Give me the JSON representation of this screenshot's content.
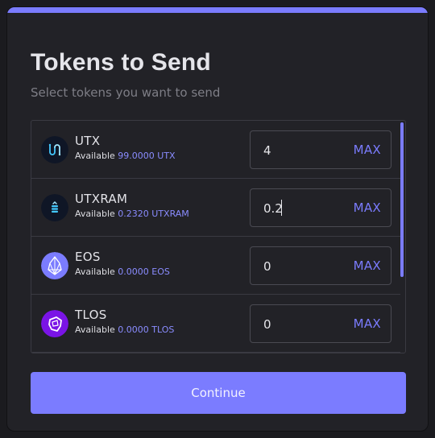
{
  "colors": {
    "accent": "#7b7cff",
    "background": "#222227",
    "border": "#3a3a42"
  },
  "header": {
    "title": "Tokens to Send",
    "subtitle": "Select tokens you want to send"
  },
  "tokens": [
    {
      "symbol": "UTX",
      "icon": "utx-token-icon",
      "available_label": "Available",
      "available_amount": "99.0000 UTX",
      "value": "4",
      "max_label": "MAX"
    },
    {
      "symbol": "UTXRAM",
      "icon": "utxram-token-icon",
      "available_label": "Available",
      "available_amount": "0.2320 UTXRAM",
      "value": "0.2",
      "max_label": "MAX"
    },
    {
      "symbol": "EOS",
      "icon": "eos-token-icon",
      "available_label": "Available",
      "available_amount": "0.0000 EOS",
      "value": "0",
      "max_label": "MAX"
    },
    {
      "symbol": "TLOS",
      "icon": "tlos-token-icon",
      "available_label": "Available",
      "available_amount": "0.0000 TLOS",
      "value": "0",
      "max_label": "MAX"
    }
  ],
  "footer": {
    "continue_label": "Continue"
  }
}
